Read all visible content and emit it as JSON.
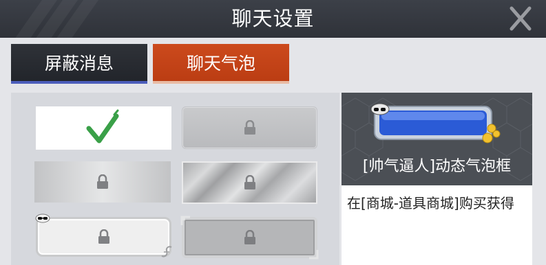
{
  "window": {
    "title": "聊天设置",
    "close_icon": "close-x-icon"
  },
  "tabs": [
    {
      "label": "屏蔽消息",
      "selected": false,
      "color": "#2a2d33"
    },
    {
      "label": "聊天气泡",
      "selected": true,
      "color": "#c4441a"
    }
  ],
  "bubbles": [
    {
      "style": "white-default",
      "state": "selected",
      "icon": "checkmark-icon"
    },
    {
      "style": "gray-plain",
      "state": "locked",
      "icon": "lock-icon"
    },
    {
      "style": "silver-gradient",
      "state": "locked",
      "icon": "lock-icon"
    },
    {
      "style": "chrome-diagonal",
      "state": "locked",
      "icon": "lock-icon"
    },
    {
      "style": "white-sunglasses",
      "state": "locked",
      "icon": "lock-icon"
    },
    {
      "style": "silver-ornate",
      "state": "locked",
      "icon": "lock-icon"
    }
  ],
  "detail": {
    "name": "[帅气逼人]动态气泡框",
    "description": "在[商城-道具商城]购买获得",
    "preview_colors": {
      "bubble": "#2b5bd6",
      "frame": "#b8c4d2",
      "coins": "#f2c12e"
    }
  },
  "colors": {
    "title_bar": "#35383f",
    "tab_active": "#c4441a",
    "tab_inactive": "#2a2d33",
    "check_green": "#3aa048"
  }
}
